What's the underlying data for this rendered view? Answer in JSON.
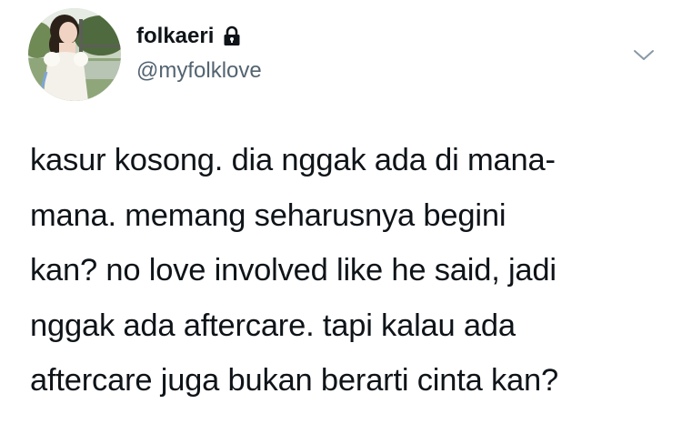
{
  "tweet": {
    "author": {
      "display_name": "folkaeri",
      "handle": "@myfolklove",
      "protected_icon": "lock-icon",
      "avatar_icon": "avatar-photo"
    },
    "menu_icon": "chevron-down-icon",
    "text": "kasur kosong. dia nggak ada di mana-\nmana. memang seharusnya begini\nkan? no love involved like he said, jadi\nnggak ada aftercare. tapi kalau ada\naftercare juga bukan berarti cinta kan?"
  },
  "colors": {
    "text_primary": "#0f1419",
    "text_secondary": "#536471",
    "caret": "#8899a6"
  }
}
